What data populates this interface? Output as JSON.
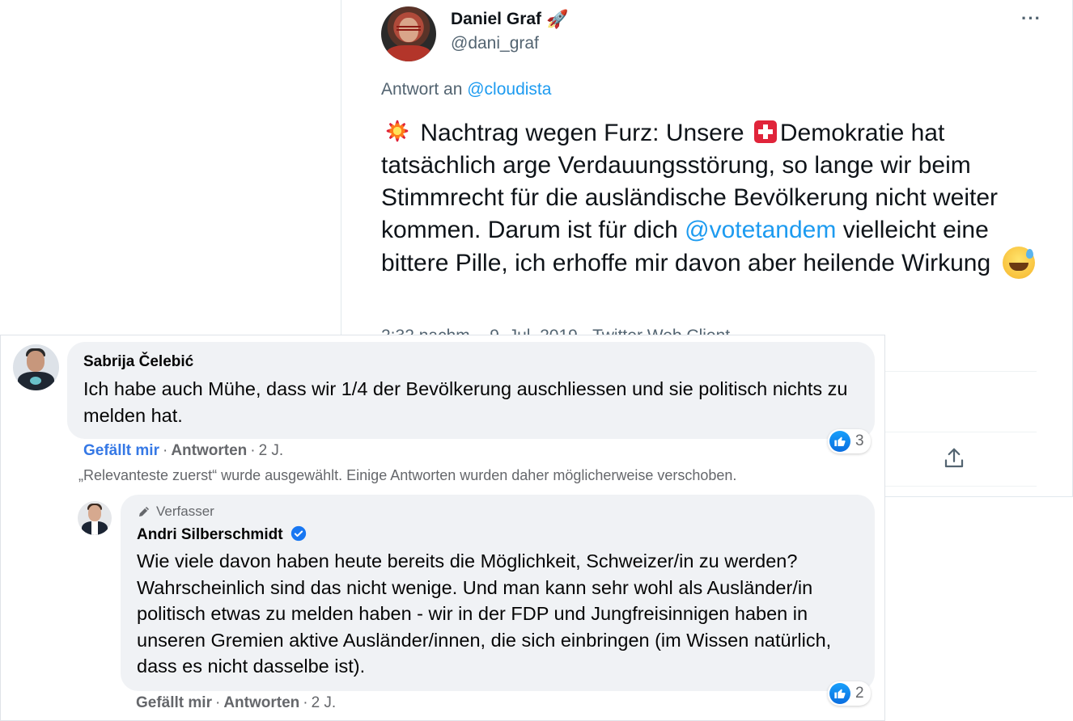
{
  "tweet": {
    "author_name": "Daniel Graf",
    "author_handle": "@dani_graf",
    "more_label": "···",
    "reply_prefix": "Antwort an",
    "reply_to": "@cloudista",
    "text_part1": "Nachtrag wegen Furz: Unsere",
    "text_part2": "Demokratie hat tatsächlich arge Verdauungsstörung, so lange wir beim Stimmrecht für die ausländische Bevölkerung nicht weiter kommen. Darum ist für dich",
    "mention": "@votetandem",
    "text_part3": "vielleicht eine bittere Pille, ich erhoffe mir davon aber heilende Wirkung",
    "meta": "2:32 nachm. · 9. Jul. 2019 · Twitter Web Client",
    "icons": [
      "rocket-emoji",
      "collision-emoji",
      "swiss-flag-emoji",
      "sweat-smile-emoji",
      "share-icon"
    ]
  },
  "facebook": {
    "comment1": {
      "author": "Sabrija Čelebić",
      "text": "Ich habe auch Mühe, dass wir 1/4 der Bevölkerung auschliessen und sie politisch nichts zu melden hat.",
      "like_label": "Gefällt mir",
      "reply_label": "Antworten",
      "age": "2 J.",
      "reactions": "3"
    },
    "notice": "„Relevanteste zuerst“ wurde ausgewählt. Einige Antworten wurden daher möglicherweise verschoben.",
    "reply1": {
      "badge": "Verfasser",
      "author": "Andri Silberschmidt",
      "text": "Wie viele davon haben heute bereits die Möglichkeit, Schweizer/in zu werden? Wahrscheinlich sind das nicht wenige. Und man kann sehr wohl als Ausländer/in politisch etwas zu melden haben - wir in der FDP und Jungfreisinnigen haben in unseren Gremien aktive Ausländer/innen, die sich einbringen (im Wissen natürlich, dass es nicht dasselbe ist).",
      "like_label": "Gefällt mir",
      "reply_label": "Antworten",
      "age": "2 J.",
      "reactions": "2"
    },
    "colors": {
      "link_blue": "#1d9bf0",
      "fb_blue": "#3578e5",
      "bubble": "#f0f2f5"
    }
  }
}
